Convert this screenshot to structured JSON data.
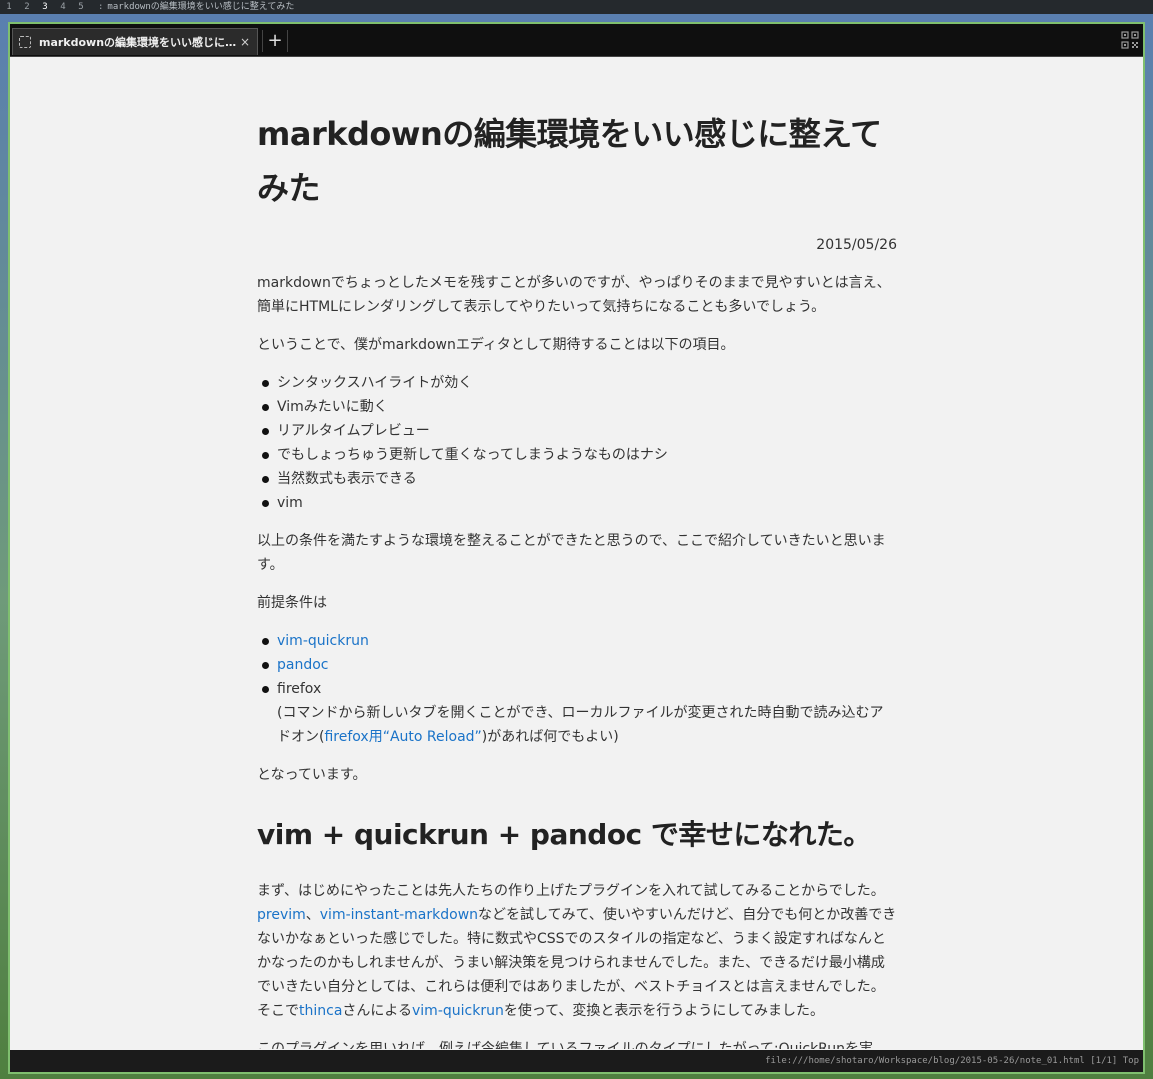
{
  "wm": {
    "workspaces": [
      "1",
      "2",
      "3",
      "4",
      "5"
    ],
    "separator": ":",
    "window_title": "markdownの編集環境をいい感じに整えてみた"
  },
  "browser": {
    "tab_title": "markdownの編集環境をいい感じに整…",
    "tab_close": "×",
    "new_tab": "+",
    "status_url": "file:///home/shotaro/Workspace/blog/2015-05-26/note_01.html [1/1] Top"
  },
  "article": {
    "title": "markdownの編集環境をいい感じに整えてみた",
    "date": "2015/05/26",
    "p1": "markdownでちょっとしたメモを残すことが多いのですが、やっぱりそのままで見やすいとは言え、簡単にHTMLにレンダリングして表示してやりたいって気持ちになることも多いでしょう。",
    "p2": "ということで、僕がmarkdownエディタとして期待することは以下の項目。",
    "expectations": [
      "シンタックスハイライトが効く",
      "Vimみたいに動く",
      "リアルタイムプレビュー",
      "でもしょっちゅう更新して重くなってしまうようなものはナシ",
      "当然数式も表示できる",
      "vim"
    ],
    "p3": "以上の条件を満たすような環境を整えることができたと思うので、ここで紹介していきたいと思います。",
    "p4": "前提条件は",
    "prereq": {
      "link1": "vim-quickrun",
      "link2": "pandoc",
      "item3": "firefox",
      "item3_note_a": "(コマンドから新しいタブを開くことができ、ローカルファイルが変更された時自動で読み込むアドオン(",
      "item3_link": "firefox用“Auto Reload”",
      "item3_note_b": ")があれば何でもよい)"
    },
    "p5": "となっています。",
    "h2": "vim + quickrun + pandoc で幸せになれた。",
    "p6_a": "まず、はじめにやったことは先人たちの作り上げたプラグインを入れて試してみることからでした。",
    "p6_link1": "previm",
    "p6_comma": "、",
    "p6_link2": "vim-instant-markdown",
    "p6_b": "などを試してみて、使いやすいんだけど、自分でも何とか改善できないかなぁといった感じでした。特に数式やCSSでのスタイルの指定など、うまく設定すればなんとかなったのかもしれませんが、うまい解決策を見つけられませんでした。また、できるだけ最小構成でいきたい自分としては、これらは便利ではありましたが、ベストチョイスとは言えませんでした。そこで",
    "p6_link3": "thinca",
    "p6_c": "さんによる",
    "p6_link4": "vim-quickrun",
    "p6_d": "を使って、変換と表示を行うようにしてみました。",
    "p7": "このプラグインを用いれば、例えば今編集しているファイルのタイプにしたがって:QuickRunを実"
  },
  "colors": {
    "link": "#1a73c8",
    "window_border": "#7fbf6f",
    "page_bg": "#f2f2f2"
  }
}
